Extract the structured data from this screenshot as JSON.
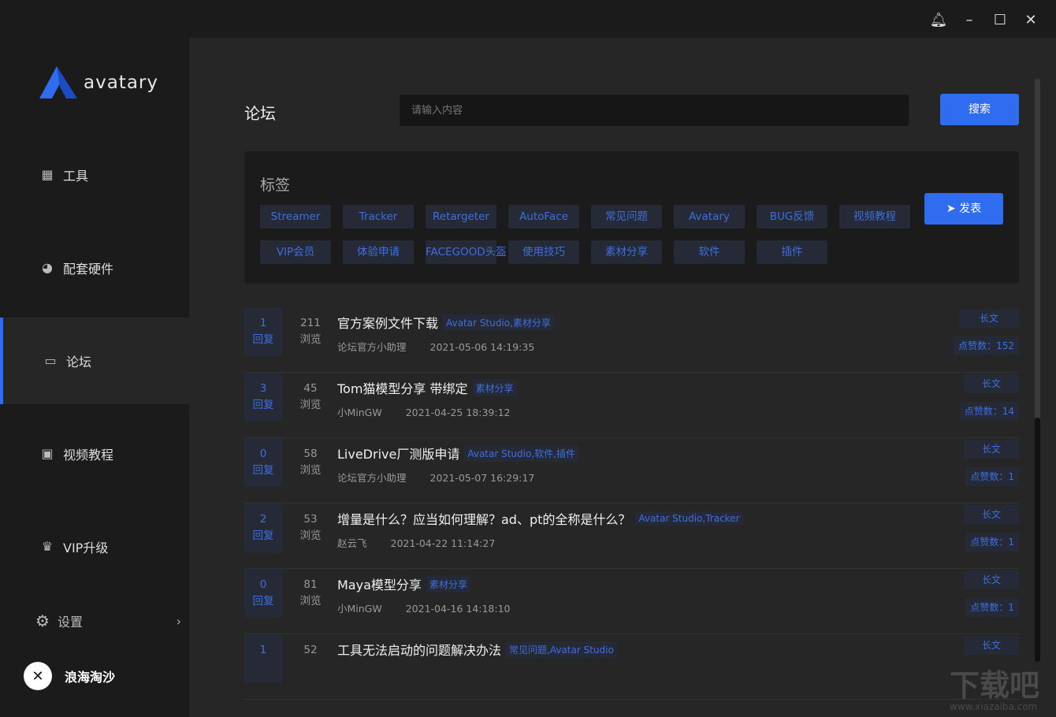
{
  "app": {
    "brand": "avatary"
  },
  "sidebar": {
    "items": [
      {
        "label": "工具"
      },
      {
        "label": "配套硬件"
      },
      {
        "label": "论坛"
      },
      {
        "label": "视频教程"
      },
      {
        "label": "VIP升级"
      }
    ],
    "settings": "设置",
    "user": "浪海淘沙"
  },
  "main": {
    "title": "论坛",
    "search_placeholder": "请输入内容",
    "search_button": "搜索",
    "tags_title": "标签",
    "post_button": "发表",
    "tags": [
      "Streamer",
      "Tracker",
      "Retargeter",
      "AutoFace",
      "常见问题",
      "Avatary",
      "BUG反馈",
      "视频教程",
      "VIP会员",
      "体验申请",
      "FACEGOOD头盔",
      "使用技巧",
      "素材分享",
      "软件",
      "插件"
    ],
    "reply_label": "回复",
    "views_label": "浏览",
    "posts": [
      {
        "replies": "1",
        "views": "211",
        "title": "官方案例文件下载",
        "tags": "Avatar Studio,素材分享",
        "author": "论坛官方小助理",
        "date": "2021-05-06 14:19:35",
        "type": "长文",
        "likes": "点赞数：152"
      },
      {
        "replies": "3",
        "views": "45",
        "title": "Tom猫模型分享 带绑定",
        "tags": "素材分享",
        "author": "小MinGW",
        "date": "2021-04-25 18:39:12",
        "type": "长文",
        "likes": "点赞数：14"
      },
      {
        "replies": "0",
        "views": "58",
        "title": "LiveDrive厂测版申请",
        "tags": "Avatar Studio,软件,插件",
        "author": "论坛官方小助理",
        "date": "2021-05-07 16:29:17",
        "type": "长文",
        "likes": "点赞数：1"
      },
      {
        "replies": "2",
        "views": "53",
        "title": "增量是什么？应当如何理解？ad、pt的全称是什么？",
        "tags": "Avatar Studio,Tracker",
        "author": "赵云飞",
        "date": "2021-04-22 11:14:27",
        "type": "长文",
        "likes": "点赞数：1"
      },
      {
        "replies": "0",
        "views": "81",
        "title": "Maya模型分享",
        "tags": "素材分享",
        "author": "小MinGW",
        "date": "2021-04-16 14:18:10",
        "type": "长文",
        "likes": "点赞数：1"
      },
      {
        "replies": "1",
        "views": "52",
        "title": "工具无法启动的问题解决办法",
        "tags": "常见问题,Avatar Studio",
        "type": "长文"
      }
    ]
  },
  "watermark": {
    "text": "下载吧",
    "url": "www.xiazaiba.com"
  }
}
